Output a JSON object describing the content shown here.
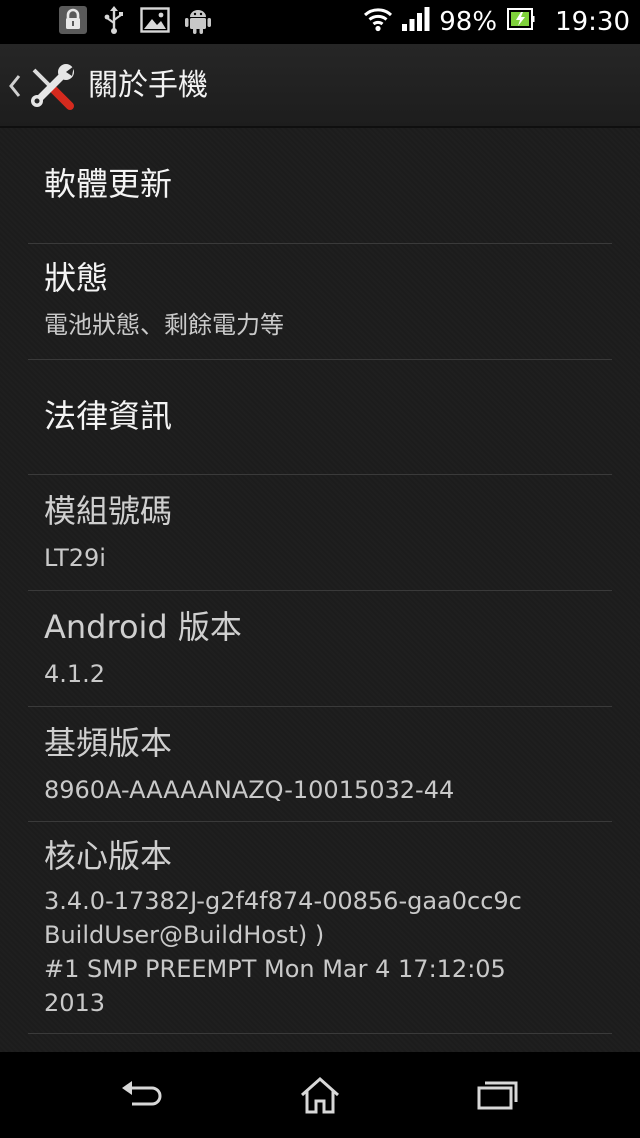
{
  "status_bar": {
    "battery_percent": "98%",
    "time": "19:30",
    "icons": [
      "lock-icon",
      "usb-icon",
      "image-icon",
      "android-icon",
      "wifi-icon",
      "signal-icon",
      "battery-icon"
    ]
  },
  "action_bar": {
    "title": "關於手機",
    "icon": "wrench-screwdriver-icon"
  },
  "items": [
    {
      "title": "軟體更新",
      "subtitle": ""
    },
    {
      "title": "狀態",
      "subtitle": "電池狀態、剩餘電力等"
    },
    {
      "title": "法律資訊",
      "subtitle": ""
    },
    {
      "title": "模組號碼",
      "subtitle": "LT29i"
    },
    {
      "title": "Android 版本",
      "subtitle": "4.1.2"
    },
    {
      "title": "基頻版本",
      "subtitle": "8960A-AAAAANAZQ-10015032-44"
    },
    {
      "title": "核心版本",
      "subtitle": "3.4.0-17382J-g2f4f874-00856-gaa0cc9c\nBuildUser@BuildHost) )\n#1 SMP PREEMPT Mon Mar 4 17:12:05\n2013"
    }
  ],
  "nav_bar": {
    "icons": [
      "back-icon",
      "home-icon",
      "recent-apps-icon"
    ]
  },
  "colors": {
    "background": "#1c1c1c",
    "status_bar": "#000000",
    "text_primary": "#f4f4f4",
    "text_secondary": "#c9c9c9",
    "divider": "#3a3a3a",
    "battery_fill": "#7fd13b"
  }
}
